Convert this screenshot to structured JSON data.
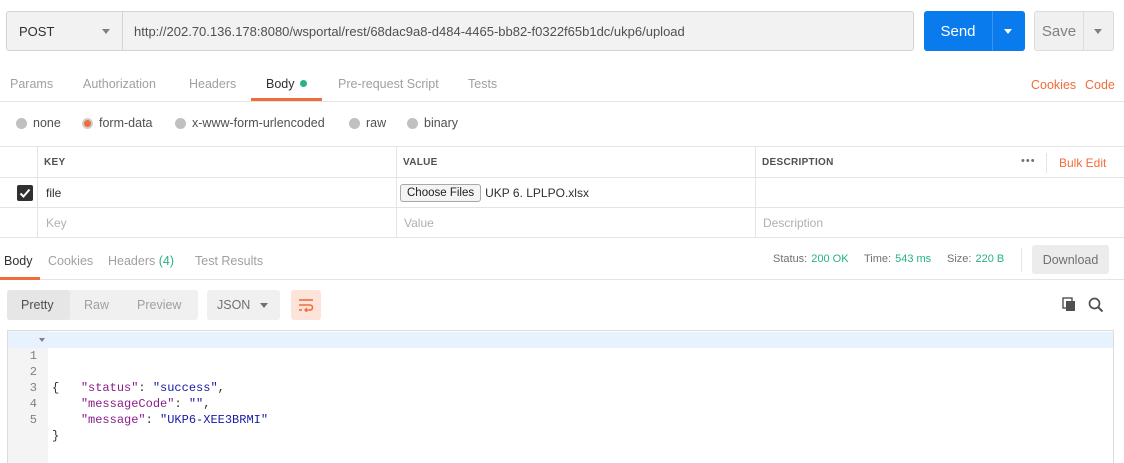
{
  "request": {
    "method": "POST",
    "url": "http://202.70.136.178:8080/wsportal/rest/68dac9a8-d484-4465-bb82-f0322f65b1dc/ukp6/upload",
    "send_label": "Send",
    "save_label": "Save"
  },
  "request_tabs": {
    "items": [
      "Params",
      "Authorization",
      "Headers",
      "Body",
      "Pre-request Script",
      "Tests"
    ],
    "active": "Body",
    "cookies_link": "Cookies",
    "code_link": "Code"
  },
  "body_types": {
    "options": [
      "none",
      "form-data",
      "x-www-form-urlencoded",
      "raw",
      "binary"
    ],
    "selected": "form-data"
  },
  "params_table": {
    "headers": [
      "KEY",
      "VALUE",
      "DESCRIPTION"
    ],
    "bulk_edit": "Bulk Edit",
    "more": "•••",
    "rows": [
      {
        "checked": true,
        "key": "file",
        "file_button": "Choose Files",
        "value": "UKP 6. LPLPO.xlsx",
        "description": ""
      }
    ],
    "placeholders": {
      "key": "Key",
      "value": "Value",
      "description": "Description"
    }
  },
  "response_tabs": {
    "items": [
      "Body",
      "Cookies",
      "Headers",
      "Test Results"
    ],
    "headers_count": "(4)",
    "active": "Body"
  },
  "response_status": {
    "status_label": "Status:",
    "status_value": "200 OK",
    "time_label": "Time:",
    "time_value": "543 ms",
    "size_label": "Size:",
    "size_value": "220 B",
    "download_label": "Download"
  },
  "response_view": {
    "formats": [
      "Pretty",
      "Raw",
      "Preview"
    ],
    "active_format": "Pretty",
    "language": "JSON"
  },
  "response_body": {
    "lines": [
      {
        "n": "1",
        "text": "{"
      },
      {
        "n": "2",
        "key": "\"status\"",
        "value": "\"success\"",
        "trail": ","
      },
      {
        "n": "3",
        "key": "\"messageCode\"",
        "value": "\"\"",
        "trail": ","
      },
      {
        "n": "4",
        "key": "\"message\"",
        "value": "\"UKP6-XEE3BRMI\"",
        "trail": ""
      },
      {
        "n": "5",
        "text": "}"
      }
    ]
  },
  "colors": {
    "accent_orange": "#f26b3a",
    "send_blue": "#097bed",
    "status_green": "#26b47f"
  }
}
